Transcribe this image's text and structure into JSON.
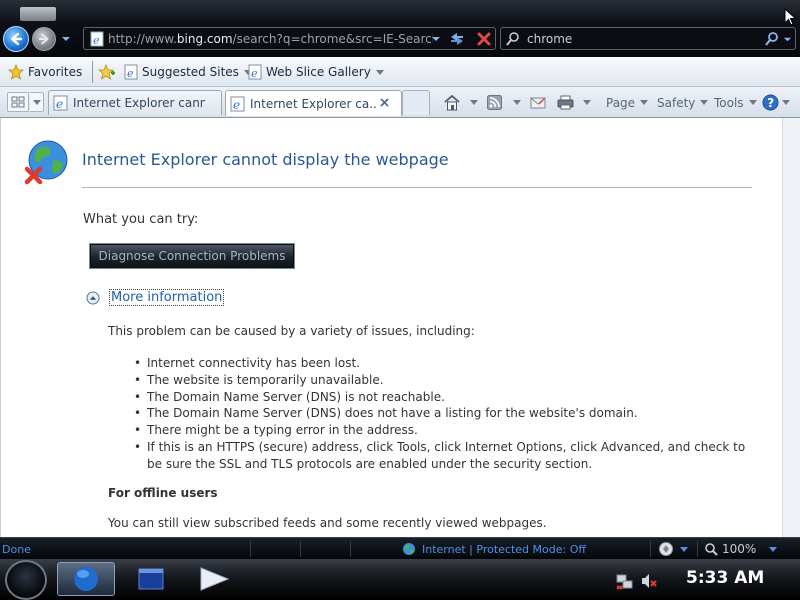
{
  "navigation": {
    "back_icon": "back-arrow-icon",
    "forward_icon": "forward-arrow-icon",
    "address_url_prefix": "http://www.",
    "address_url_domain": "bing.com",
    "address_url_suffix": "/search?q=chrome&src=IE-SearchBo",
    "search_value": "chrome"
  },
  "favorites_bar": {
    "favorites_label": "Favorites",
    "suggested_sites_label": "Suggested Sites",
    "web_slice_gallery_label": "Web Slice Gallery"
  },
  "tabs": [
    {
      "title": "Internet Explorer canno..."
    },
    {
      "title": "Internet Explorer ca..."
    }
  ],
  "command_bar": {
    "page_label": "Page",
    "safety_label": "Safety",
    "tools_label": "Tools"
  },
  "error_page": {
    "title": "Internet Explorer cannot display the webpage",
    "what_you_can_try": "What you can try:",
    "diagnose_button": "Diagnose Connection Problems",
    "more_information": "More information",
    "cause_intro": "This problem can be caused by a variety of issues, including:",
    "causes": [
      "Internet connectivity has been lost.",
      "The website is temporarily unavailable.",
      "The Domain Name Server (DNS) is not reachable.",
      "The Domain Name Server (DNS) does not have a listing for the website's domain.",
      "There might be a typing error in the address.",
      "If this is an HTTPS (secure) address, click Tools, click Internet Options, click Advanced, and check to be sure the SSL and TLS protocols are enabled under the security section."
    ],
    "offline_heading": "For offline users",
    "offline_text": "You can still view subscribed feeds and some recently viewed webpages."
  },
  "status_bar": {
    "status": "Done",
    "zone": "Internet | Protected Mode: Off",
    "zoom": "100%"
  },
  "taskbar": {
    "clock": "5:33 AM"
  },
  "colors": {
    "link_blue": "#1f5fb0",
    "title_blue": "#2a5795",
    "status_blue": "#4f8fe6"
  }
}
